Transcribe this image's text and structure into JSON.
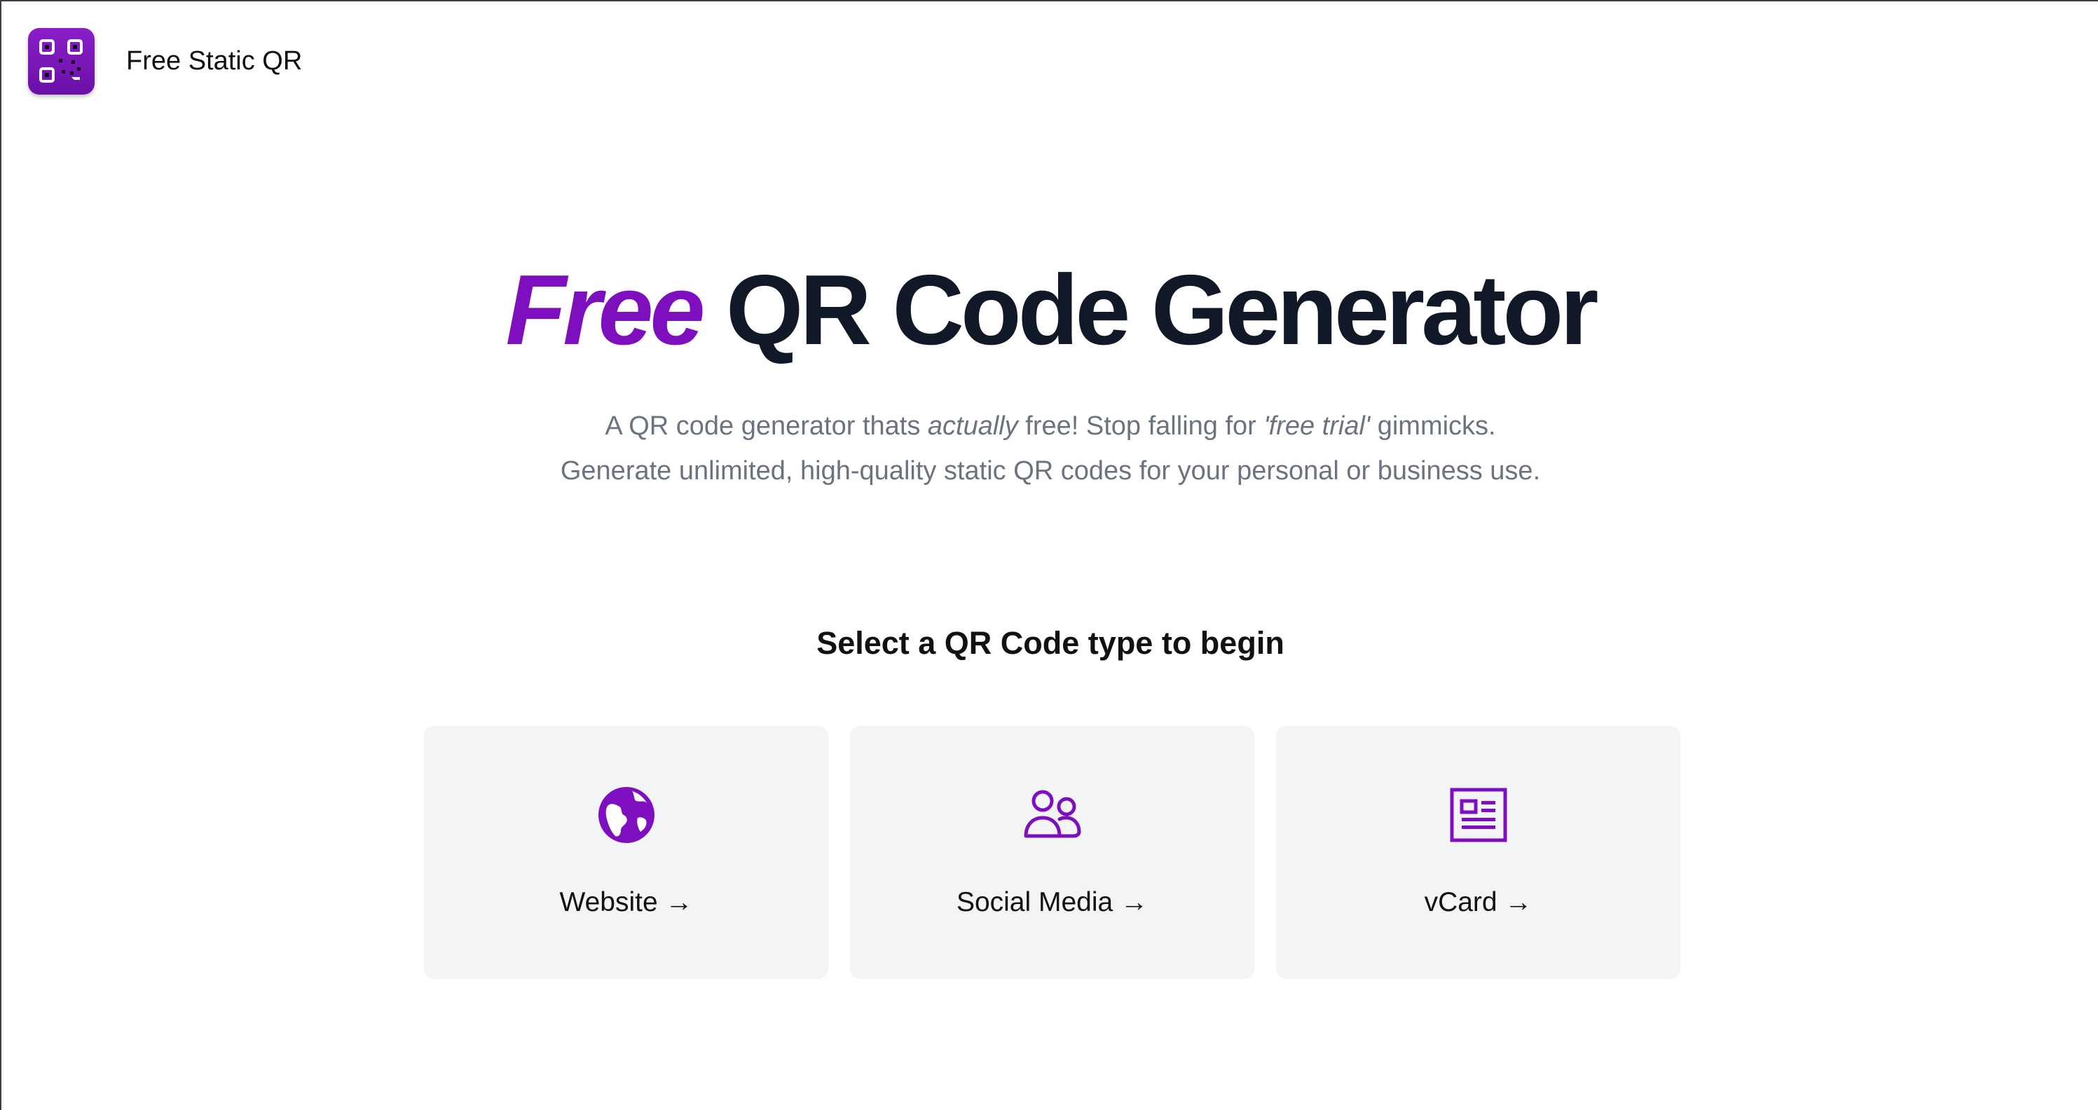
{
  "header": {
    "brand": "Free Static QR",
    "logo_icon": "qr-code-icon"
  },
  "hero": {
    "title_accent": "Free",
    "title_rest": " QR Code Generator",
    "subtitle_line1_a": "A QR code generator thats ",
    "subtitle_line1_em1": "actually",
    "subtitle_line1_b": " free! Stop falling for ",
    "subtitle_line1_em2": "'free trial'",
    "subtitle_line1_c": " gimmicks.",
    "subtitle_line2": "Generate unlimited, high-quality static QR codes for your personal or business use."
  },
  "select_title": "Select a QR Code type to begin",
  "cards": [
    {
      "label": "Website →",
      "icon": "globe-icon"
    },
    {
      "label": "Social Media →",
      "icon": "users-icon"
    },
    {
      "label": "vCard →",
      "icon": "vcard-icon"
    }
  ],
  "colors": {
    "accent": "#7e0fbf",
    "title": "#111827",
    "subtitle": "#6b7280",
    "card_bg": "#f3f4f6"
  }
}
